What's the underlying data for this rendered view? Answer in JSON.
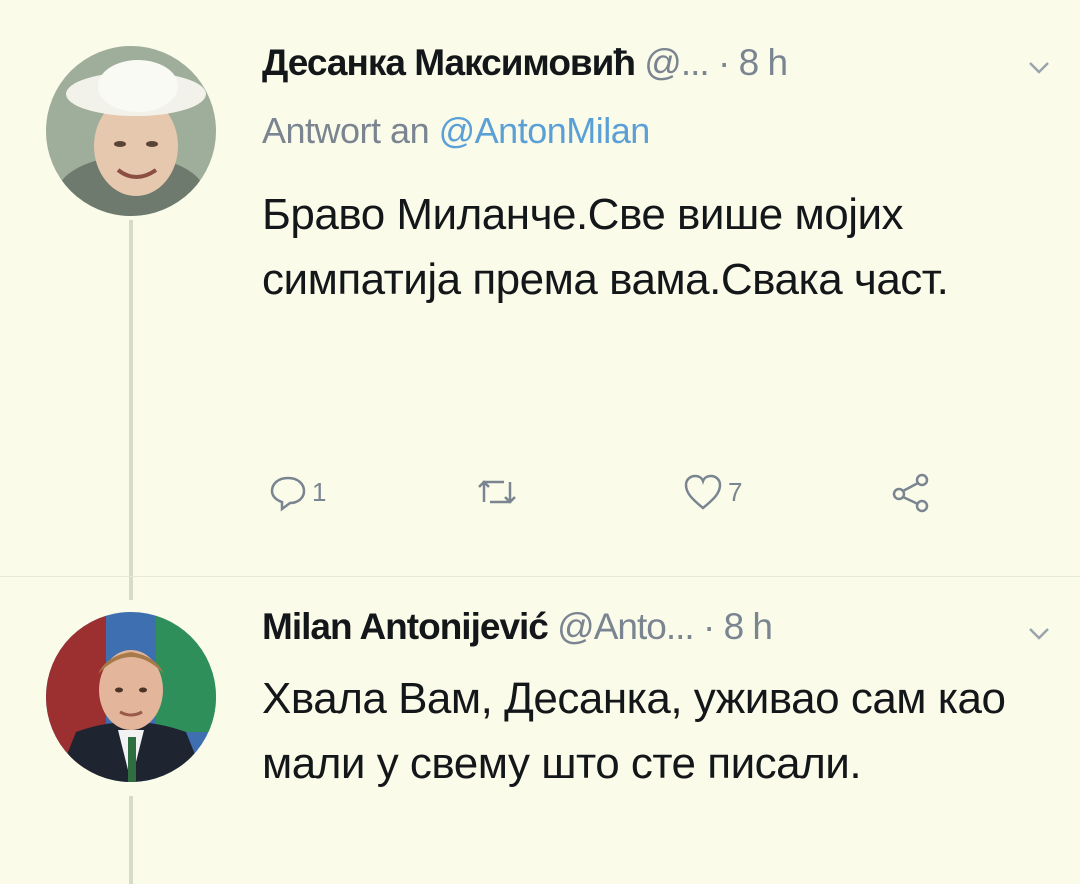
{
  "tweets": [
    {
      "author_name": "Десанка Максимовић",
      "handle": "@...",
      "separator": "·",
      "time": "8 h",
      "reply_prefix": "Antwort an",
      "reply_mention": "@AntonMilan",
      "text": "Браво Миланче.Све више мојих симпатија према вама.Свака част.",
      "actions": {
        "reply_count": "1",
        "retweet_count": "",
        "like_count": "7"
      }
    },
    {
      "author_name": "Milan Antonijević",
      "handle": "@Anto...",
      "separator": "·",
      "time": "8 h",
      "text": "Хвала Вам, Десанка, уживао сам као мали у свему што сте писали."
    }
  ],
  "icons": {
    "reply": "reply-icon",
    "retweet": "retweet-icon",
    "like": "heart-icon",
    "share": "share-icon",
    "menu": "chevron-down-icon"
  },
  "colors": {
    "background": "#fbfbe9",
    "text": "#14171a",
    "secondary": "#7a8591",
    "link": "#5aa0d6"
  }
}
